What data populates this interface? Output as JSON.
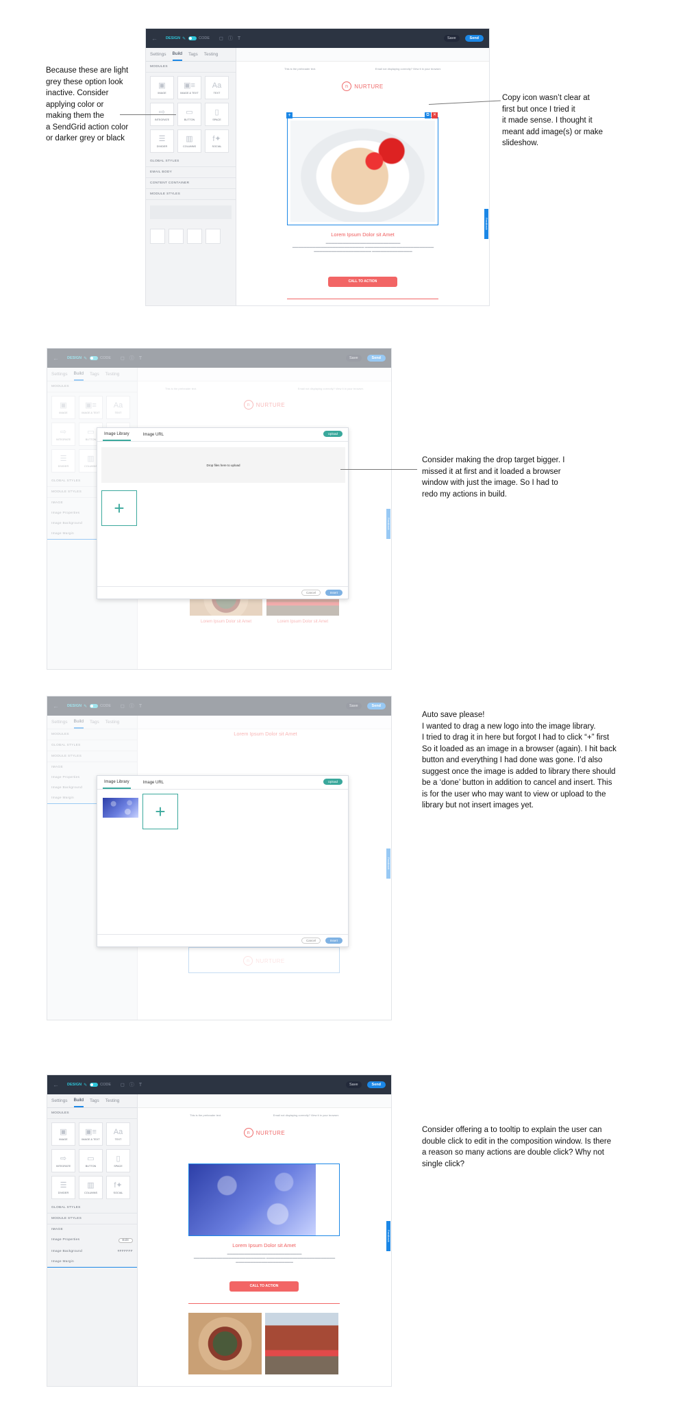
{
  "notes": [
    {
      "lines": [
        "Because these are light",
        "grey these option look",
        "inactive. Consider",
        "applying color or",
        "making them the",
        "a SendGrid action color",
        "or darker grey or black"
      ]
    },
    {
      "lines": [
        "Copy icon wasn’t clear at",
        "first but once I tried it",
        "it made sense. I thought it",
        "meant add image(s) or make",
        "slideshow."
      ]
    },
    {
      "lines": [
        "Consider making the drop target bigger. I",
        "missed it at first and it loaded a browser",
        "window with just the image. So I had to",
        "redo my actions in build."
      ]
    },
    {
      "lines": [
        "Auto save please!",
        "I wanted to drag a new logo into the image library.",
        "I tried to drag it in here but forgot I had to click “+” first",
        "So it loaded as an image in a browser (again). I hit back",
        "button and everything I had done was gone. I’d also",
        "suggest once the image is added to library there should",
        "be a ‘done’ button in addition to cancel and insert. This",
        "is for the user who may want to view or upload to the",
        "library but not insert images yet."
      ]
    },
    {
      "lines": [
        "Consider offering a to tooltip to explain the user can",
        "double click to edit in the composition window. Is there",
        "a reason so many actions are double click? Why not",
        "single click?"
      ]
    }
  ],
  "editor": {
    "design": "DESIGN",
    "code": "CODE",
    "save": "Save",
    "send": "Send",
    "tabs": [
      "Settings",
      "Build",
      "Tags",
      "Testing"
    ],
    "sections": {
      "modules": "MODULES",
      "global_styles": "GLOBAL STYLES",
      "email_body": "EMAIL BODY",
      "content_container": "CONTENT CONTAINER",
      "module_styles": "MODULE STYLES"
    },
    "modules": [
      "IMAGE",
      "IMAGE & TEXT",
      "TEXT",
      "INTEGRATE",
      "BUTTON",
      "SPACE",
      "DIVIDER",
      "COLUMNS",
      "SOCIAL"
    ],
    "preheader": "This is the preheader text.",
    "view_browser": "Email not displaying correctly? View it in your browser.",
    "brand": "NURTURE",
    "headline": "Lorem Ipsum Dolor sit Amet",
    "cta": "CALL TO ACTION",
    "feedback": "Feedback",
    "image_label": "IMAGE",
    "image_properties": "Image Properties",
    "image_background": "Image Background",
    "image_margin": "Image Margin",
    "edit": "Edit",
    "bg_value": "#FFFFFF"
  },
  "modal": {
    "tab_library": "Image Library",
    "tab_url": "Image URL",
    "upload": "Upload",
    "drop": "Drop files here to upload",
    "cancel": "Cancel",
    "insert": "Insert"
  }
}
